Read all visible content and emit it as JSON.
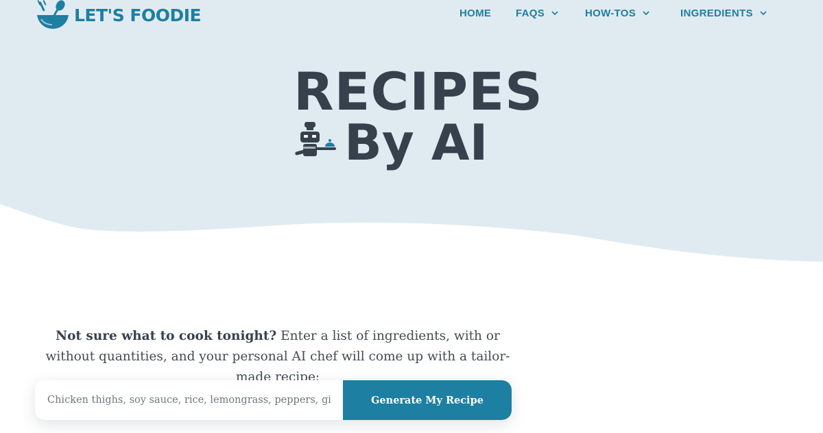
{
  "brand": {
    "logo_text": "LET'S FOODIE"
  },
  "nav": {
    "items": [
      {
        "label": "HOME",
        "has_dropdown": false
      },
      {
        "label": "FAQS",
        "has_dropdown": true
      },
      {
        "label": "HOW-TOS",
        "has_dropdown": true
      },
      {
        "label": "INGREDIENTS",
        "has_dropdown": true
      }
    ]
  },
  "hero": {
    "title_line1": "RECIPES",
    "title_line2": "By AI"
  },
  "intro": {
    "bold_lead": "Not sure what to cook tonight?",
    "text": " Enter a list of ingredients, with or without quantities, and your personal AI chef will come up with a tailor-made recipe:"
  },
  "search": {
    "value": "",
    "placeholder": "Chicken thighs, soy sauce, rice, lemongrass, peppers, ginger...",
    "button_label": "Generate My Recipe"
  },
  "icons": {
    "logo": "bowl-fork-spoon-icon",
    "dropdown": "chevron-down-icon",
    "chef": "robot-chef-icon"
  },
  "colors": {
    "accent": "#1d7fa1",
    "hero_bg": "#e0ebf1",
    "title_text": "#37414d",
    "body_text": "#444a52"
  }
}
